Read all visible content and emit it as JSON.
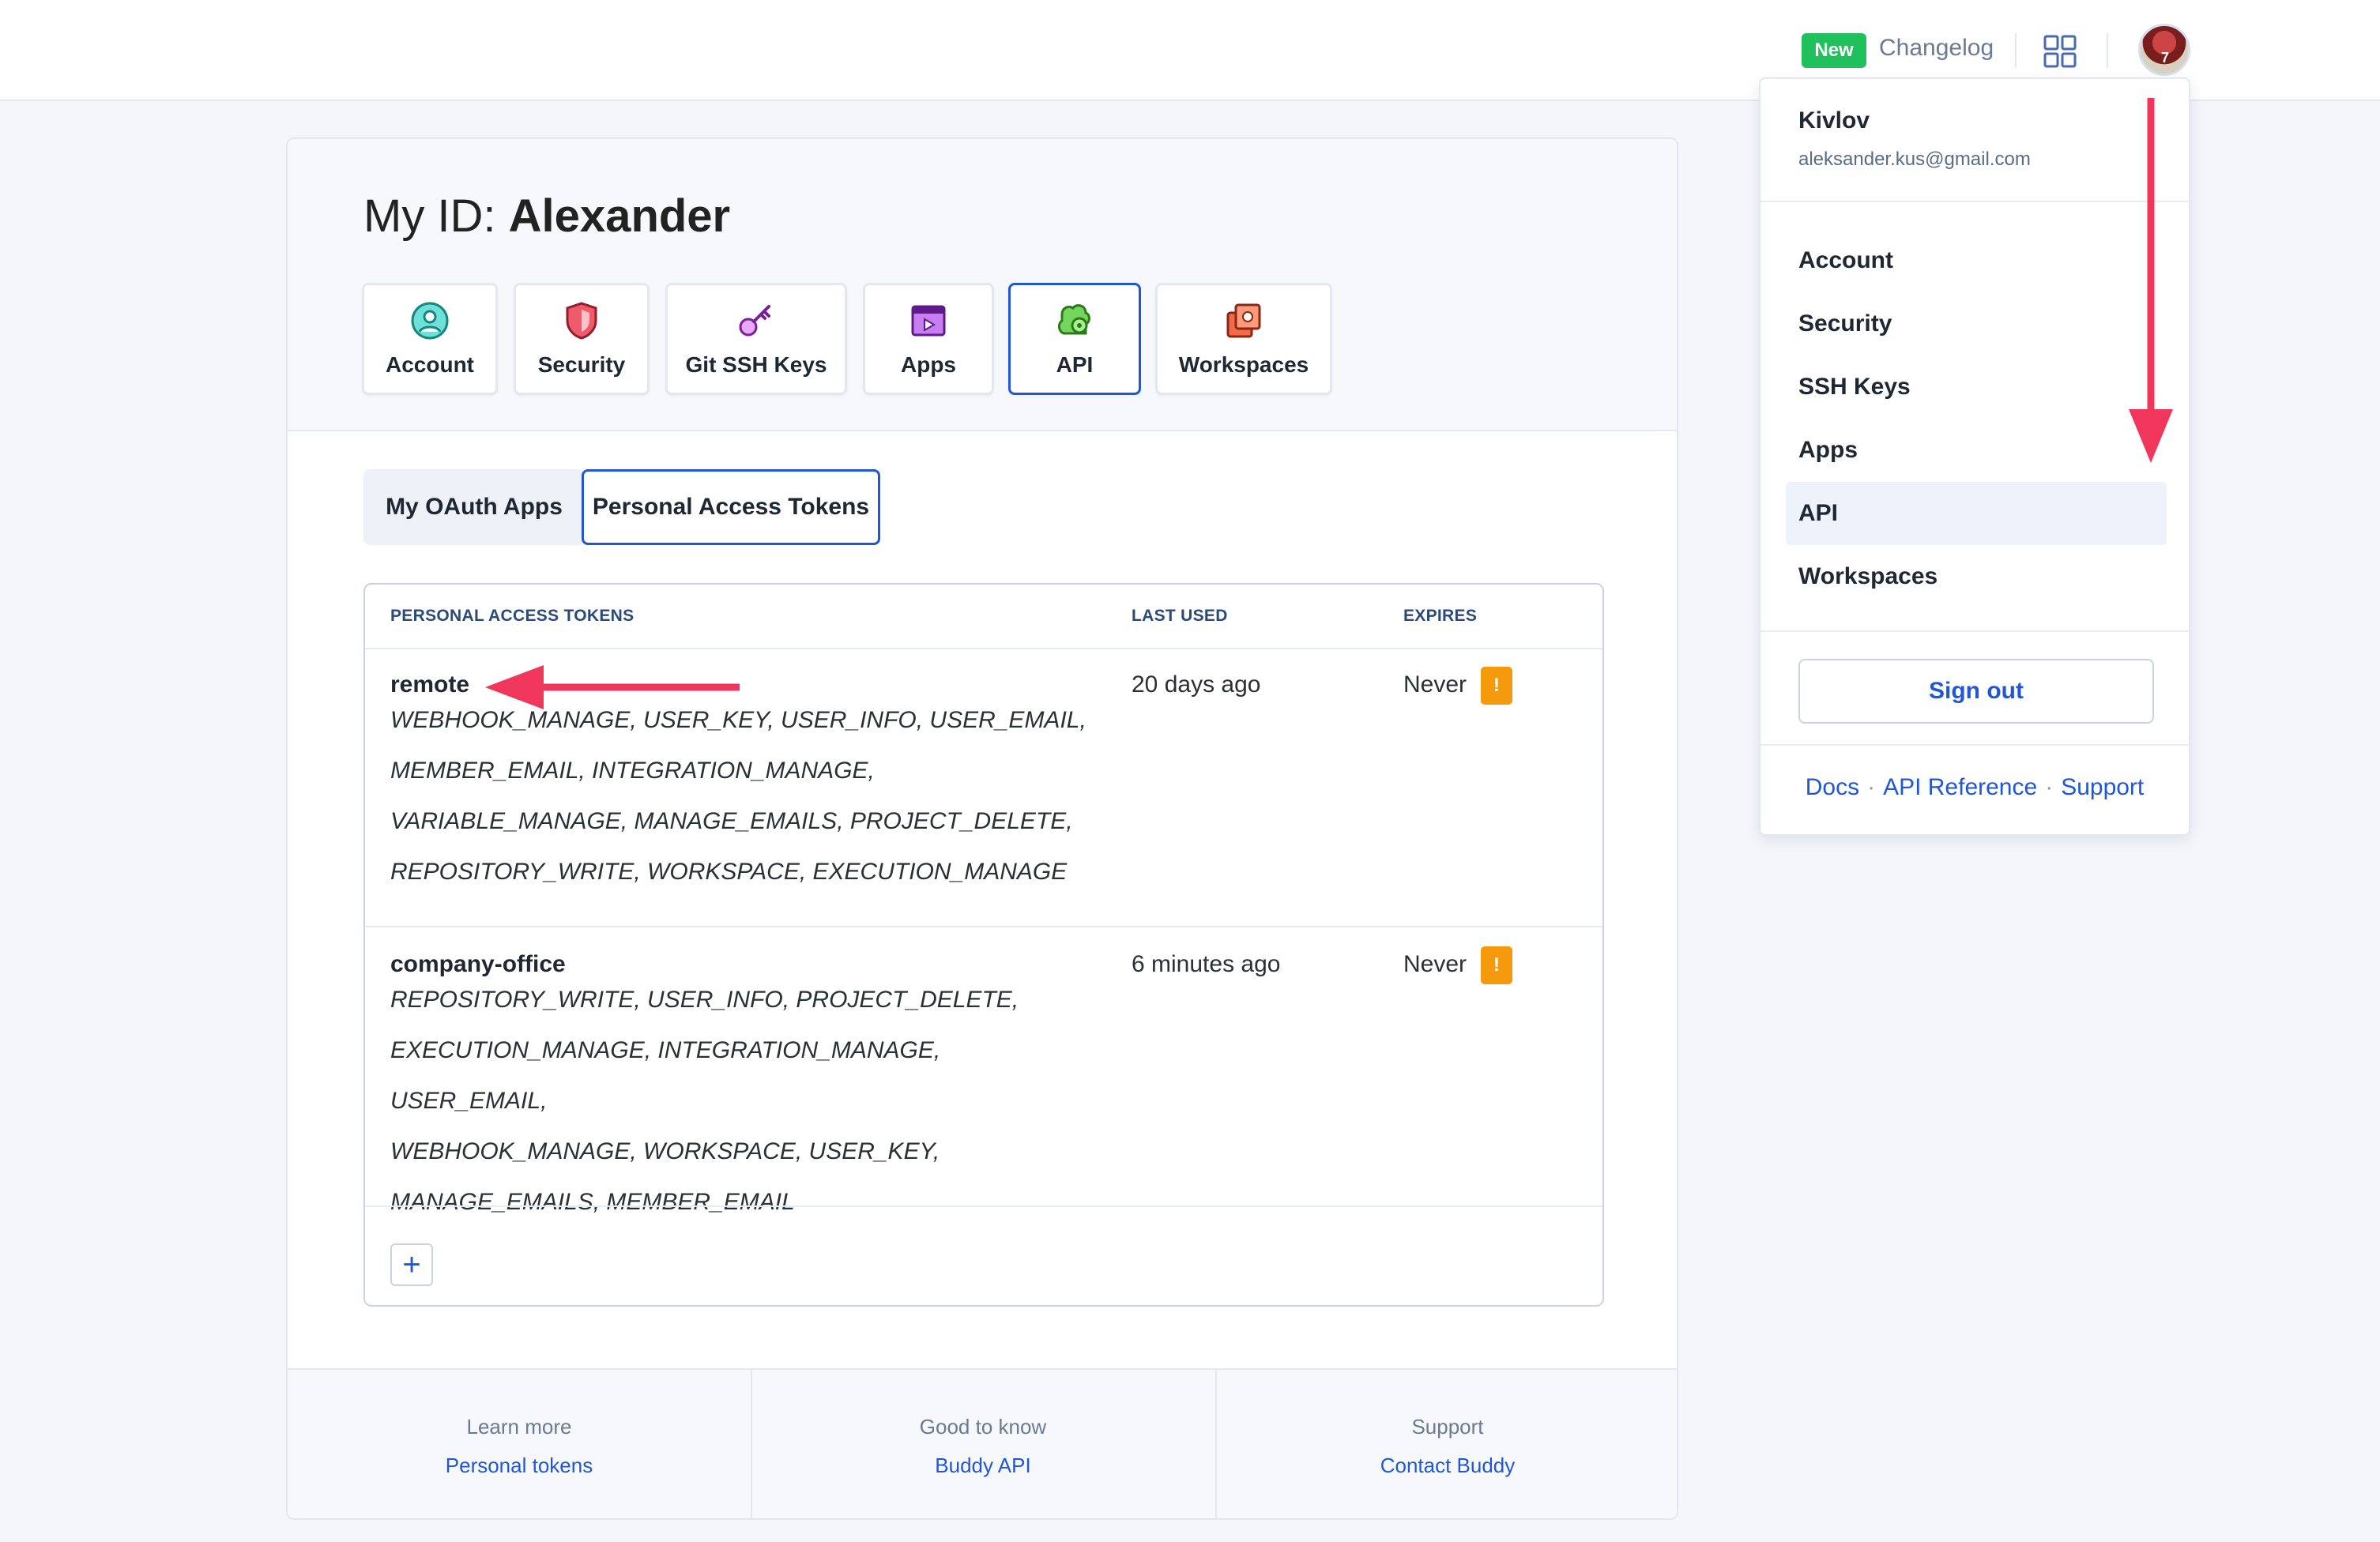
{
  "topbar": {
    "new_badge": "New",
    "changelog": "Changelog",
    "avatar_number": "7"
  },
  "page": {
    "title_prefix": "My ID: ",
    "title_name": "Alexander"
  },
  "tabs": [
    {
      "label": "Account",
      "icon": "account-icon"
    },
    {
      "label": "Security",
      "icon": "shield-icon"
    },
    {
      "label": "Git SSH Keys",
      "icon": "key-icon"
    },
    {
      "label": "Apps",
      "icon": "apps-icon"
    },
    {
      "label": "API",
      "icon": "api-gear-icon",
      "active": true
    },
    {
      "label": "Workspaces",
      "icon": "workspaces-icon"
    }
  ],
  "subtabs": [
    {
      "label": "My OAuth Apps"
    },
    {
      "label": "Personal Access Tokens",
      "active": true
    }
  ],
  "table": {
    "headers": [
      "PERSONAL ACCESS TOKENS",
      "LAST USED",
      "EXPIRES"
    ],
    "rows": [
      {
        "name": "remote",
        "scopes": [
          "WEBHOOK_MANAGE, USER_KEY, USER_INFO, USER_EMAIL,",
          "MEMBER_EMAIL, INTEGRATION_MANAGE,",
          "VARIABLE_MANAGE, MANAGE_EMAILS, PROJECT_DELETE,",
          "REPOSITORY_WRITE, WORKSPACE, EXECUTION_MANAGE"
        ],
        "last_used": "20 days ago",
        "expires": "Never",
        "warning": "!"
      },
      {
        "name": "company-office",
        "scopes": [
          "REPOSITORY_WRITE, USER_INFO, PROJECT_DELETE,",
          "EXECUTION_MANAGE, INTEGRATION_MANAGE, USER_EMAIL,",
          "WEBHOOK_MANAGE, WORKSPACE, USER_KEY,",
          "MANAGE_EMAILS, MEMBER_EMAIL"
        ],
        "last_used": "6 minutes ago",
        "expires": "Never",
        "warning": "!"
      }
    ],
    "add_button": "+"
  },
  "footer": [
    {
      "caption": "Learn more",
      "link": "Personal tokens"
    },
    {
      "caption": "Good to know",
      "link": "Buddy API"
    },
    {
      "caption": "Support",
      "link": "Contact Buddy"
    }
  ],
  "dropdown": {
    "user": "Kivlov",
    "email": "aleksander.kus@gmail.com",
    "items": [
      "Account",
      "Security",
      "SSH Keys",
      "Apps",
      "API",
      "Workspaces"
    ],
    "active_item": "API",
    "sign_out": "Sign out",
    "links": [
      "Docs",
      "API Reference",
      "Support"
    ],
    "link_separator": "·"
  },
  "colors": {
    "accent": "#2057d6",
    "annotation_arrow": "#f0365a",
    "warning": "#f59a0c",
    "new_badge": "#20c15c"
  }
}
